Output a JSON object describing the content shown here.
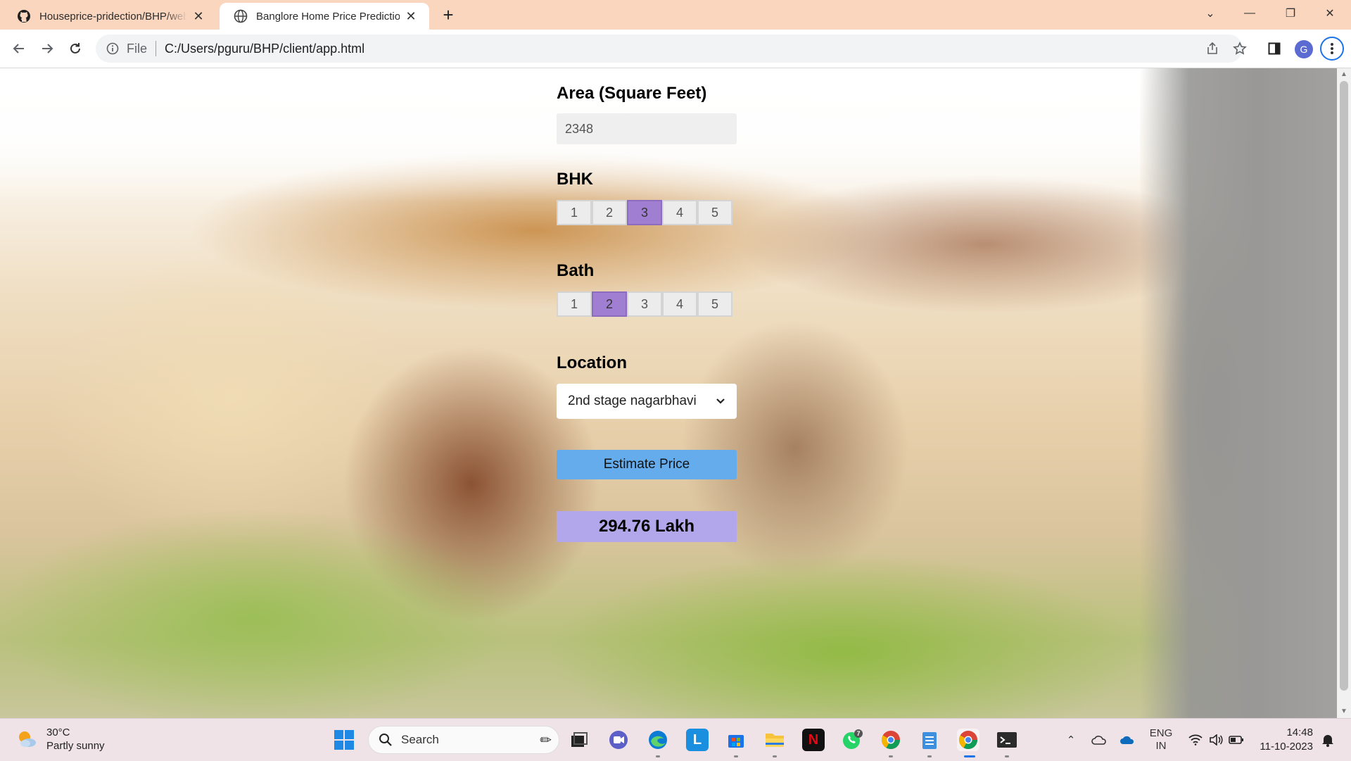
{
  "browser": {
    "tabs": [
      {
        "title": "Houseprice-pridection/BHP/web",
        "active": false
      },
      {
        "title": "Banglore Home Price Prediction",
        "active": true
      }
    ],
    "new_tab": "+",
    "omnibox": {
      "scheme": "File",
      "url": "C:/Users/pguru/BHP/client/app.html"
    },
    "profile_initial": "G"
  },
  "form": {
    "area_label": "Area (Square Feet)",
    "area_value": "2348",
    "bhk_label": "BHK",
    "bhk_options": [
      "1",
      "2",
      "3",
      "4",
      "5"
    ],
    "bhk_selected": "3",
    "bath_label": "Bath",
    "bath_options": [
      "1",
      "2",
      "3",
      "4",
      "5"
    ],
    "bath_selected": "2",
    "location_label": "Location",
    "location_value": "2nd stage nagarbhavi",
    "estimate_button": "Estimate Price",
    "result": "294.76 Lakh"
  },
  "colors": {
    "selected_option": "#a07fd3",
    "button": "#65acec",
    "result_bg": "#b2a7ea",
    "titlebar": "#fbd6bf"
  },
  "taskbar": {
    "weather_temp": "30°C",
    "weather_desc": "Partly sunny",
    "search_placeholder": "Search",
    "lang_top": "ENG",
    "lang_bottom": "IN",
    "time": "14:48",
    "date": "11-10-2023",
    "whatsapp_badge": "7",
    "apps": [
      "windows-start",
      "search",
      "file-explorer-task-view",
      "meet",
      "edge",
      "lumin",
      "microsoft-store",
      "file-explorer",
      "netflix",
      "whatsapp",
      "chrome-profile",
      "notepad",
      "chrome-active",
      "terminal"
    ]
  }
}
